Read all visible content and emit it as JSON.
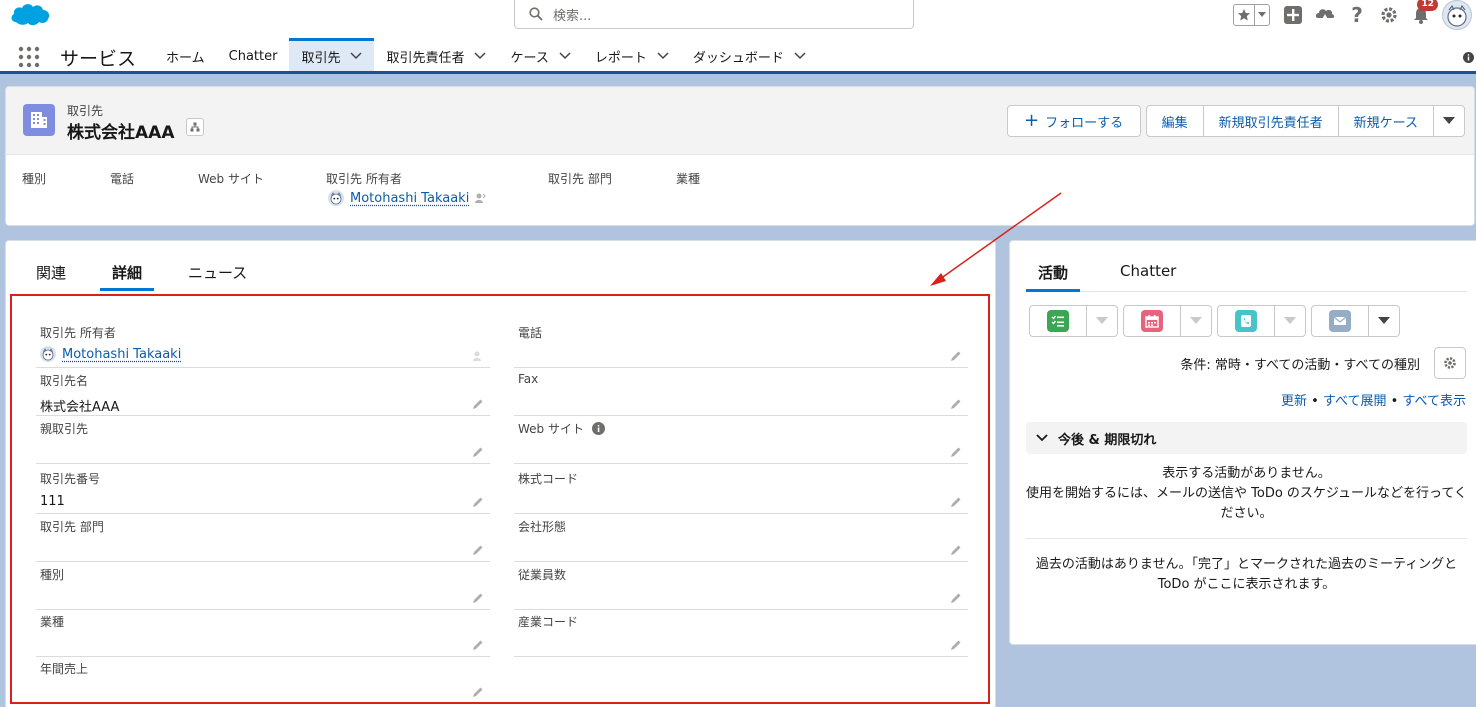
{
  "header": {
    "search_placeholder": "検索...",
    "notification_count": "12",
    "colors": {
      "brand": "#00a1e0",
      "nav_active": "#0176d3",
      "nav_border": "#1b5297",
      "highlight_box": "#d8221b"
    }
  },
  "nav": {
    "app_name": "サービス",
    "items": [
      {
        "label": "ホーム",
        "has_menu": false
      },
      {
        "label": "Chatter",
        "has_menu": false
      },
      {
        "label": "取引先",
        "has_menu": true,
        "active": true
      },
      {
        "label": "取引先責任者",
        "has_menu": true
      },
      {
        "label": "ケース",
        "has_menu": true
      },
      {
        "label": "レポート",
        "has_menu": true
      },
      {
        "label": "ダッシュボード",
        "has_menu": true
      }
    ]
  },
  "record": {
    "object_label": "取引先",
    "name": "株式会社AAA",
    "icon": "account-building-icon",
    "actions": {
      "follow": "フォローする",
      "edit": "編集",
      "new_contact": "新規取引先責任者",
      "new_case": "新規ケース"
    },
    "highlights": {
      "type": "種別",
      "phone": "電話",
      "website": "Web サイト",
      "owner": "取引先 所有者",
      "division": "取引先 部門",
      "industry": "業種",
      "owner_value": "Motohashi Takaaki"
    }
  },
  "main_tabs": {
    "related": "関連",
    "details": "詳細",
    "news": "ニュース"
  },
  "details": {
    "owner_label": "取引先 所有者",
    "owner_value": "Motohashi Takaaki",
    "phone_label": "電話",
    "name_label": "取引先名",
    "name_value": "株式会社AAA",
    "fax_label": "Fax",
    "parent_label": "親取引先",
    "website_label": "Web サイト",
    "number_label": "取引先番号",
    "number_value": "111",
    "ticker_label": "株式コード",
    "division_label": "取引先 部門",
    "ownership_label": "会社形態",
    "type_label": "種別",
    "employees_label": "従業員数",
    "industry_label": "業種",
    "sic_label": "産業コード",
    "revenue_label": "年間売上"
  },
  "activity": {
    "tab_activity": "活動",
    "tab_chatter": "Chatter",
    "filter_text": "条件: 常時・すべての活動・すべての種別",
    "link_refresh": "更新",
    "link_expand": "すべて展開",
    "link_view_all": "すべて表示",
    "sep": " • ",
    "upcoming_title": "今後 & 期限切れ",
    "no_activity_1": "表示する活動がありません。",
    "no_activity_2": "使用を開始するには、メールの送信や ToDo のスケジュールなどを行ってください。",
    "past_text": "過去の活動はありません。「完了」とマークされた過去のミーティングと ToDo がここに表示されます。"
  }
}
